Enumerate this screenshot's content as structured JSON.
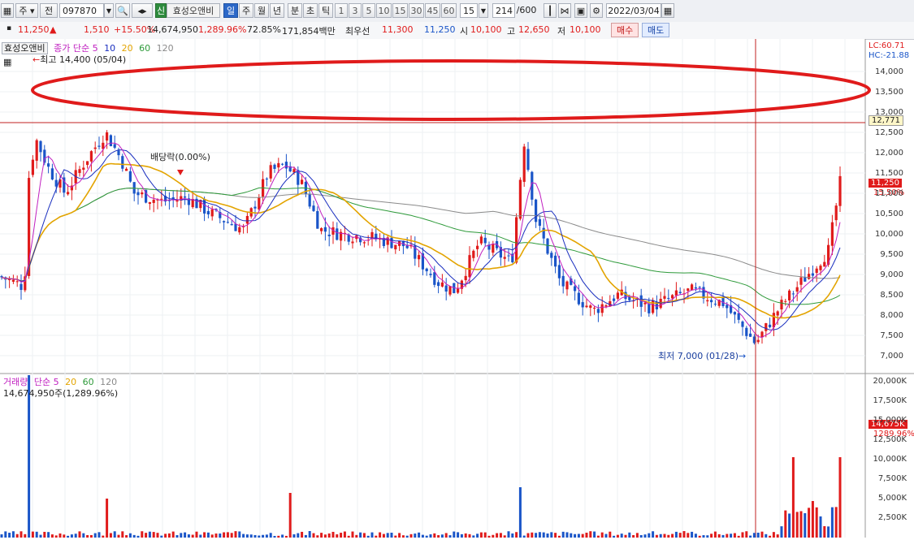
{
  "toolbar": {
    "mode1": "주",
    "mode2": "전",
    "code": "097870",
    "stock_name": "효성오앤비",
    "badge": "신",
    "periods": [
      "일",
      "주",
      "월",
      "년",
      "분",
      "초",
      "틱"
    ],
    "active_period": "일",
    "intervals": [
      "1",
      "3",
      "5",
      "10",
      "15",
      "30",
      "45",
      "60"
    ],
    "interval_value": "15",
    "count_value": "214",
    "count_total": "/600",
    "date": "2022/03/04"
  },
  "quote": {
    "price": "11,250",
    "change": "1,510",
    "change_pct": "+15.50%",
    "volume": "14,674,950",
    "volume_pct": "1,289.96%",
    "ratio": "72.85%",
    "amount": "171,854백만",
    "best_label": "최우선",
    "best_ask": "11,300",
    "best_bid": "11,250",
    "open_label": "시",
    "open": "10,100",
    "high_label": "고",
    "high": "12,650",
    "low_label": "저",
    "low": "10,100",
    "buy_label": "매수",
    "sell_label": "매도"
  },
  "price_panel": {
    "legend_name": "효성오앤비",
    "legend_series": "종가 단순",
    "ma_periods": [
      "5",
      "10",
      "20",
      "60",
      "120"
    ],
    "lc": "LC:60.71",
    "hc": "HC:-21.88",
    "high_annotation": "최고 14,400 (05/04)",
    "low_annotation": "최저 7,000 (01/28)",
    "dividend_annotation": "배당락(0.00%)",
    "crosshair_value": "12,771",
    "price_tag": "11,250",
    "pct_tag": "15.50%",
    "y_ticks": [
      "14,000",
      "13,500",
      "13,000",
      "12,500",
      "12,000",
      "11,500",
      "11,000",
      "10,500",
      "10,000",
      "9,500",
      "9,000",
      "8,500",
      "8,000",
      "7,500",
      "7,000"
    ]
  },
  "volume_panel": {
    "legend_name": "거래량",
    "legend_series": "단순",
    "ma_periods": [
      "5",
      "20",
      "60",
      "120"
    ],
    "volume_text": "14,674,950주(1,289.96%)",
    "vol_tag": "14,675K",
    "vol_pct_tag": "1289.96%",
    "y_ticks": [
      "20,000K",
      "17,500K",
      "15,000K",
      "12,500K",
      "10,000K",
      "7,500K",
      "5,000K",
      "2,500K"
    ]
  },
  "colors": {
    "up": "#e01b1b",
    "down": "#1a55c8",
    "ma5": "#c020c0",
    "ma10": "#1a2fbf",
    "ma20": "#e3a400",
    "ma60": "#2e9a3a",
    "ma120": "#8a8a8a",
    "ellipse": "#e01b1b"
  }
}
